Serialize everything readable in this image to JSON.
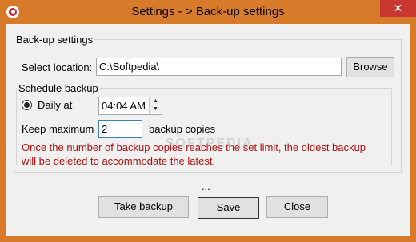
{
  "window": {
    "title": "Settings - > Back-up settings",
    "close_glyph": "✕",
    "accent": "#d77b2a"
  },
  "backup": {
    "group_label": "Back-up settings",
    "location_label": "Select location:",
    "location_value": "C:\\Softpedia\\",
    "browse_label": "Browse"
  },
  "schedule": {
    "group_label": "Schedule backup",
    "daily_label": "Daily at",
    "time_value": "04:04 AM",
    "keep_label": "Keep maximum",
    "max_value": "2",
    "copies_label": "backup copies",
    "warning_line1": "Once the number of backup copies reaches the set limit, the oldest backup",
    "warning_line2": "will be deleted to accommodate the latest.",
    "warning_color": "#b01010"
  },
  "footer": {
    "status": "...",
    "take_backup_label": "Take backup",
    "save_label": "Save",
    "close_label": "Close"
  },
  "watermark": {
    "text": "SOFTPEDIA"
  }
}
